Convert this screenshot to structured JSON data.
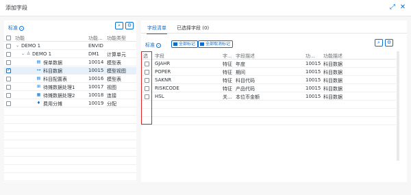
{
  "dialog": {
    "title": "添加字段"
  },
  "left": {
    "variant": "标准",
    "headers": {
      "function": "功能",
      "code": "功能...",
      "type": "功能类型"
    },
    "rows": [
      {
        "label": "DEMO 1",
        "code": "ENVID",
        "type": ""
      },
      {
        "label": "DEMO 1",
        "code": "DM1",
        "type": "计算单元"
      },
      {
        "label": "保单数据",
        "code": "10014",
        "type": "模型表"
      },
      {
        "label": "科目数据",
        "code": "10015",
        "type": "模型视图"
      },
      {
        "label": "科目配置表",
        "code": "10016",
        "type": "模型表"
      },
      {
        "label": "待摊数据处理1",
        "code": "10017",
        "type": "视图"
      },
      {
        "label": "待摊数据处理2",
        "code": "10018",
        "type": "连接"
      },
      {
        "label": "费用分摊",
        "code": "10019",
        "type": "分配"
      }
    ]
  },
  "right": {
    "tabs": [
      "字段清单",
      "已选择字段 (0)"
    ],
    "variant": "标准",
    "select_all": "全部标记",
    "deselect_all": "全部取消标记",
    "headers": {
      "select": "选",
      "field": "字段",
      "type": "字...",
      "desc": "字段描述",
      "func": "功...",
      "func_desc": "功能描述"
    },
    "rows": [
      {
        "field": "GJAHR",
        "type": "特征",
        "desc": "年度",
        "func": "10015",
        "func_desc": "科目数据"
      },
      {
        "field": "POPER",
        "type": "特征",
        "desc": "期间",
        "func": "10015",
        "func_desc": "科目数据"
      },
      {
        "field": "SAKNR",
        "type": "特征",
        "desc": "科目代码",
        "func": "10015",
        "func_desc": "科目数据"
      },
      {
        "field": "RISKCODE",
        "type": "特征",
        "desc": "产品代码",
        "func": "10015",
        "func_desc": "科目数据"
      },
      {
        "field": "HSL",
        "type": "关...",
        "desc": "本位币金额",
        "func": "10015",
        "func_desc": "科目数据"
      }
    ]
  },
  "colors": {
    "accent": "#0a6ed1",
    "highlight": "#e02020"
  }
}
